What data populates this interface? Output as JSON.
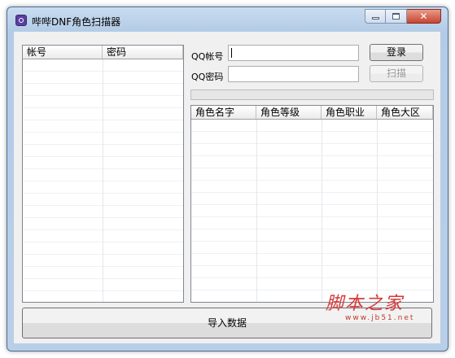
{
  "window": {
    "title": "哔哔DNF角色扫描器",
    "icon": "app-icon"
  },
  "account_table": {
    "columns": [
      "帐号",
      "密码"
    ],
    "rows": []
  },
  "login": {
    "qq_account_label": "QQ帐号",
    "qq_account_value": "",
    "qq_password_label": "QQ密码",
    "qq_password_value": "",
    "login_button": "登录",
    "scan_button": "扫描",
    "scan_enabled": false,
    "progress": 0
  },
  "role_table": {
    "columns": [
      "角色名字",
      "角色等级",
      "角色职业",
      "角色大区"
    ],
    "rows": []
  },
  "import_button": "导入数据",
  "watermark": {
    "main": "脚本之家",
    "sub": "www.jb51.net"
  },
  "colors": {
    "title_bar": "#b9cfe8",
    "close_button": "#c84431",
    "watermark": "#d63b3b"
  }
}
